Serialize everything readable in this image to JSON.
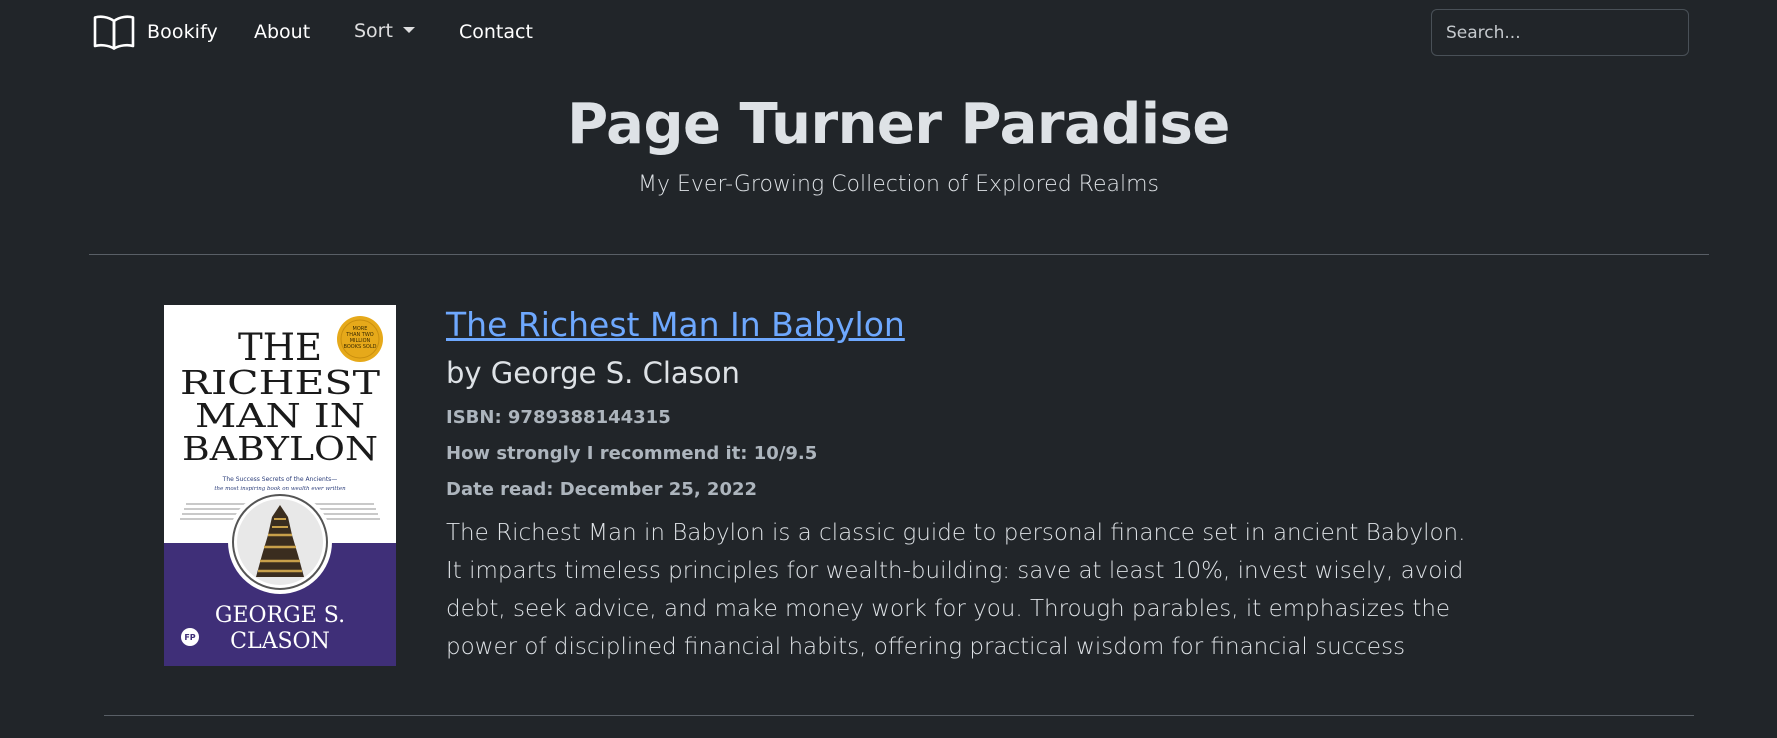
{
  "navbar": {
    "brand": {
      "label": "Bookify",
      "icon": "open-book-icon"
    },
    "links": [
      {
        "label": "About"
      },
      {
        "label": "Sort",
        "dropdown": true
      },
      {
        "label": "Contact"
      }
    ],
    "search": {
      "placeholder": "Search...",
      "value": ""
    }
  },
  "header": {
    "title": "Page Turner Paradise",
    "subtitle": "My Ever-Growing Collection of Explored Realms"
  },
  "books": [
    {
      "title": "The Richest Man In Babylon",
      "author": "by George S. Clason",
      "isbn_line": "ISBN: 9789388144315",
      "recommend_line": "How strongly I recommend it: 10/9.5",
      "date_line": "Date read: December 25, 2022",
      "description": "The Richest Man in Babylon is a classic guide to personal finance set in ancient Babylon. It imparts timeless principles for wealth-building: save at least 10%, invest wisely, avoid debt, seek advice, and make money work for you. Through parables, it emphasizes the power of disciplined financial habits, offering practical wisdom for financial success",
      "cover": {
        "title_lines": [
          "THE",
          "RICHEST",
          "MAN IN",
          "BABYLON"
        ],
        "tagline_1": "The Success Secrets of the Ancients—",
        "tagline_2": "the most inspiring book on wealth ever written",
        "badge_lines": [
          "MORE",
          "THAN TWO",
          "MILLION",
          "BOOKS SOLD"
        ],
        "author_lines": [
          "GEORGE S.",
          "CLASON"
        ],
        "publisher_mark": "FP",
        "colors": {
          "band": "#3f2f78",
          "badge": "#e6a91a",
          "paper": "#ffffff"
        }
      }
    }
  ],
  "theme": {
    "background": "#212529",
    "link": "#6ea8fe",
    "text": "#dee2e6",
    "muted": "#adb5bd"
  }
}
